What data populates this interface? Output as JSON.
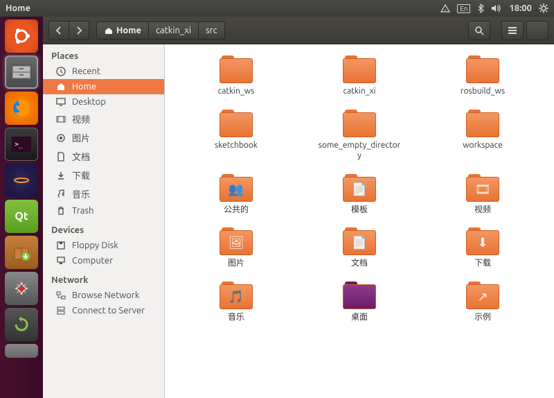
{
  "panel": {
    "title": "Home",
    "lang": "En",
    "time": "18:00"
  },
  "toolbar": {
    "path": [
      "Home",
      "catkin_xi",
      "src"
    ]
  },
  "sidebar": {
    "places_header": "Places",
    "devices_header": "Devices",
    "network_header": "Network",
    "places": [
      {
        "icon": "clock",
        "label": "Recent"
      },
      {
        "icon": "home",
        "label": "Home",
        "active": true
      },
      {
        "icon": "desktop",
        "label": "Desktop"
      },
      {
        "icon": "video",
        "label": "视频"
      },
      {
        "icon": "pic",
        "label": "图片"
      },
      {
        "icon": "doc",
        "label": "文档"
      },
      {
        "icon": "download",
        "label": "下载"
      },
      {
        "icon": "music",
        "label": "音乐"
      },
      {
        "icon": "trash",
        "label": "Trash"
      }
    ],
    "devices": [
      {
        "icon": "floppy",
        "label": "Floppy Disk"
      },
      {
        "icon": "computer",
        "label": "Computer"
      }
    ],
    "network": [
      {
        "icon": "net",
        "label": "Browse Network"
      },
      {
        "icon": "server",
        "label": "Connect to Server"
      }
    ]
  },
  "folders": [
    {
      "name": "catkin_ws",
      "type": "plain"
    },
    {
      "name": "catkin_xi",
      "type": "plain"
    },
    {
      "name": "rosbuild_ws",
      "type": "plain"
    },
    {
      "name": "sketchbook",
      "type": "plain"
    },
    {
      "name": "some_empty_directory",
      "type": "plain"
    },
    {
      "name": "workspace",
      "type": "plain"
    },
    {
      "name": "公共的",
      "type": "public"
    },
    {
      "name": "模板",
      "type": "templates"
    },
    {
      "name": "视频",
      "type": "videos"
    },
    {
      "name": "图片",
      "type": "pictures"
    },
    {
      "name": "文档",
      "type": "documents"
    },
    {
      "name": "下载",
      "type": "downloads"
    },
    {
      "name": "音乐",
      "type": "music"
    },
    {
      "name": "桌面",
      "type": "desktop"
    },
    {
      "name": "示例",
      "type": "examples"
    }
  ]
}
